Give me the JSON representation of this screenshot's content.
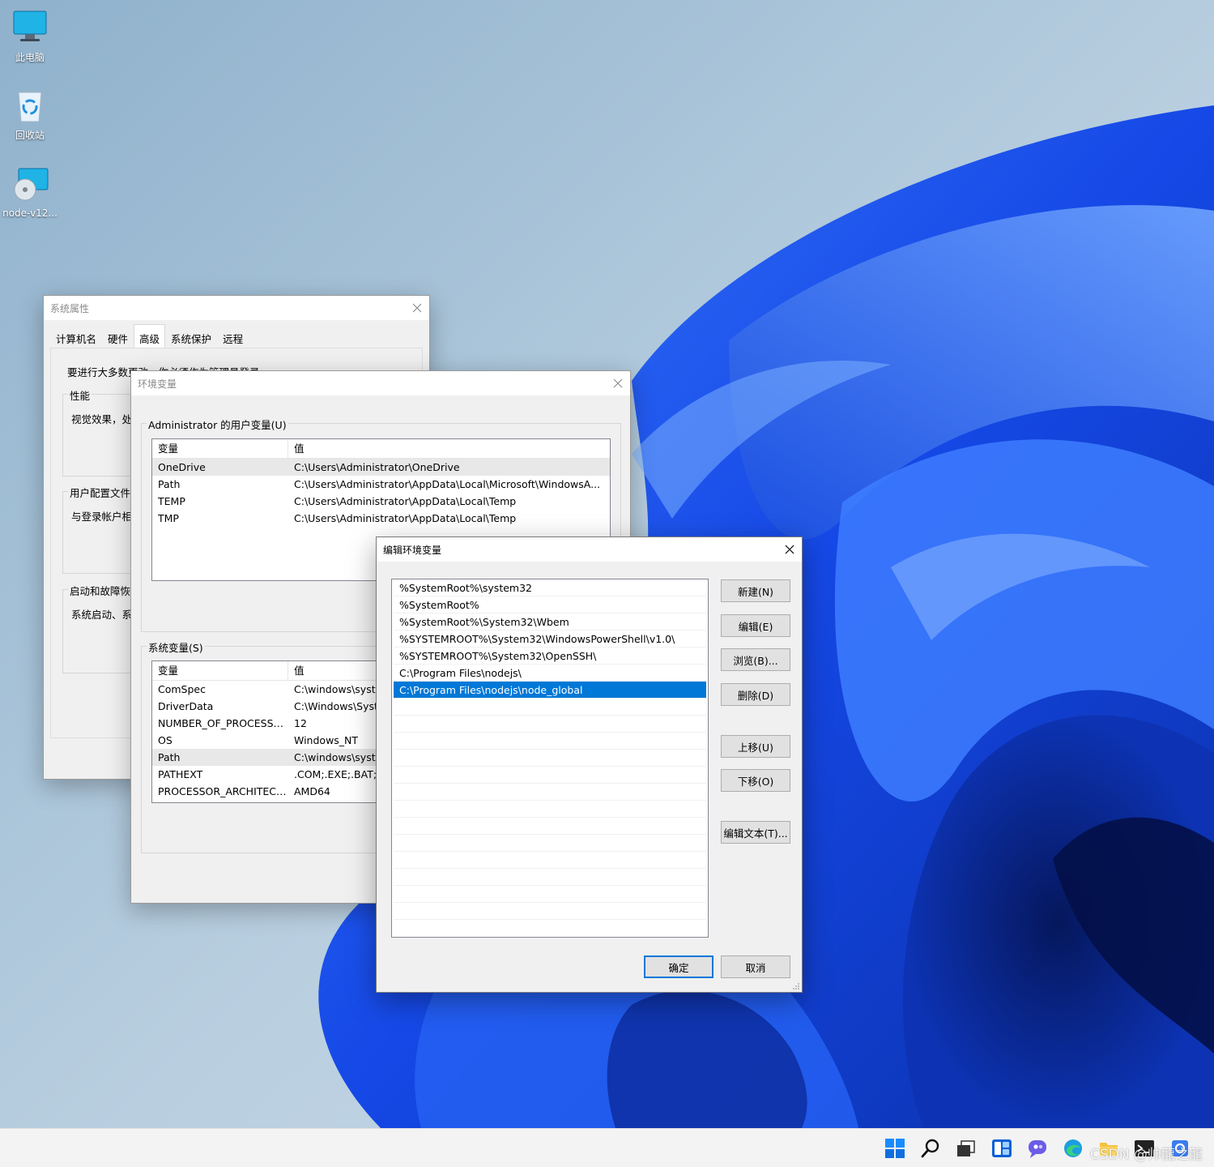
{
  "desktop": {
    "icons": [
      {
        "label": "此电脑",
        "icon": "computer-icon"
      },
      {
        "label": "回收站",
        "icon": "recycle-bin-icon"
      },
      {
        "label": "node-v12...",
        "icon": "installer-disc-icon"
      }
    ]
  },
  "system_properties": {
    "title": "系统属性",
    "tabs": [
      "计算机名",
      "硬件",
      "高级",
      "系统保护",
      "远程"
    ],
    "active_tab": "高级",
    "note": "要进行大多数更改，你必须作为管理员登录。",
    "groups": [
      {
        "legend": "性能",
        "desc": "视觉效果，处"
      },
      {
        "legend": "用户配置文件",
        "desc": "与登录帐户相"
      },
      {
        "legend": "启动和故障恢复",
        "desc": "系统启动、系"
      }
    ]
  },
  "env_vars": {
    "title": "环境变量",
    "user_section_label": "Administrator 的用户变量(U)",
    "system_section_label": "系统变量(S)",
    "col_var": "变量",
    "col_value": "值",
    "user_rows": [
      {
        "var": "OneDrive",
        "value": "C:\\Users\\Administrator\\OneDrive"
      },
      {
        "var": "Path",
        "value": "C:\\Users\\Administrator\\AppData\\Local\\Microsoft\\WindowsA..."
      },
      {
        "var": "TEMP",
        "value": "C:\\Users\\Administrator\\AppData\\Local\\Temp"
      },
      {
        "var": "TMP",
        "value": "C:\\Users\\Administrator\\AppData\\Local\\Temp"
      }
    ],
    "system_rows": [
      {
        "var": "ComSpec",
        "value": "C:\\windows\\system32\\cmd.exe"
      },
      {
        "var": "DriverData",
        "value": "C:\\Windows\\System32\\Drivers\\DriverData"
      },
      {
        "var": "NUMBER_OF_PROCESSORS",
        "value": "12"
      },
      {
        "var": "OS",
        "value": "Windows_NT"
      },
      {
        "var": "Path",
        "value": "C:\\windows\\system32"
      },
      {
        "var": "PATHEXT",
        "value": ".COM;.EXE;.BAT;.CMD"
      },
      {
        "var": "PROCESSOR_ARCHITECT...",
        "value": "AMD64"
      }
    ]
  },
  "edit_env": {
    "title": "编辑环境变量",
    "entries": [
      "%SystemRoot%\\system32",
      "%SystemRoot%",
      "%SystemRoot%\\System32\\Wbem",
      "%SYSTEMROOT%\\System32\\WindowsPowerShell\\v1.0\\",
      "%SYSTEMROOT%\\System32\\OpenSSH\\",
      "C:\\Program Files\\nodejs\\",
      "C:\\Program Files\\nodejs\\node_global"
    ],
    "selected_index": 6,
    "buttons": {
      "new": "新建(N)",
      "edit": "编辑(E)",
      "browse": "浏览(B)...",
      "delete": "删除(D)",
      "move_up": "上移(U)",
      "move_down": "下移(O)",
      "edit_text": "编辑文本(T)...",
      "ok": "确定",
      "cancel": "取消"
    }
  },
  "taskbar": {
    "icons": [
      "start-icon",
      "search-icon",
      "task-view-icon",
      "widgets-icon",
      "chat-icon",
      "edge-icon",
      "explorer-icon",
      "terminal-icon",
      "settings-icon"
    ]
  },
  "watermark": "CSDN @帅龍之龍",
  "colors": {
    "selection": "#0078d7",
    "dialog_bg": "#f0f0f0",
    "wallpaper_blue": "#1a5cff"
  }
}
